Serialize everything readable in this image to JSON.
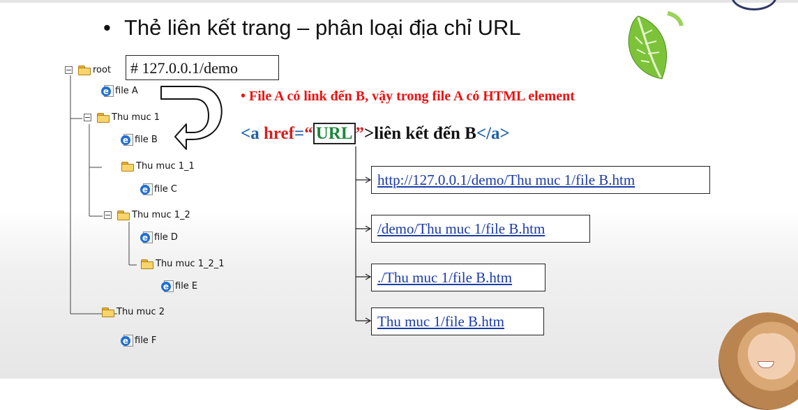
{
  "slide": {
    "bullet": "•",
    "title": "Thẻ liên kết trang – phân loại địa chỉ URL"
  },
  "tree": {
    "url_box": "# 127.0.0.1/demo",
    "nodes": {
      "root": "root",
      "fileA": "file A",
      "thumuc1": "Thu muc 1",
      "fileB": "file B",
      "thumuc1_1": "Thu muc 1_1",
      "fileC": "file C",
      "thumuc1_2": "Thu muc 1_2",
      "fileD": "file D",
      "thumuc1_2_1": "Thu muc 1_2_1",
      "fileE": "file E",
      "thumuc2": "Thu muc 2",
      "fileF": "file F"
    }
  },
  "note": "• File A có link đến B, vậy trong file A có HTML element",
  "code": {
    "open_tag": "<a ",
    "attr": "href",
    "equals": "=",
    "quote_open": "“",
    "url": "URL",
    "quote_close": "”",
    "close_bracket": ">",
    "text": "liên kết đến B",
    "end_tag": "</a>"
  },
  "url_options": [
    "http://127.0.0.1/demo/Thu muc 1/file B.htm",
    "/demo/Thu muc 1/file B.htm",
    "./Thu muc 1/file B.htm",
    "Thu muc 1/file B.htm"
  ],
  "colors": {
    "note_red": "#e11111",
    "code_blue": "#1f5fa8",
    "url_green": "#1a8a3a",
    "link_blue": "#1a3aa8",
    "folder_yellow": "#f8d56a",
    "ie_blue": "#1f6fd1"
  },
  "icons": {
    "folder": "folder-icon",
    "ie_file": "ie-file-icon",
    "expander": "minus-expander-icon",
    "leaf": "leaf-icon",
    "curved_arrow": "curved-arrow-icon"
  }
}
